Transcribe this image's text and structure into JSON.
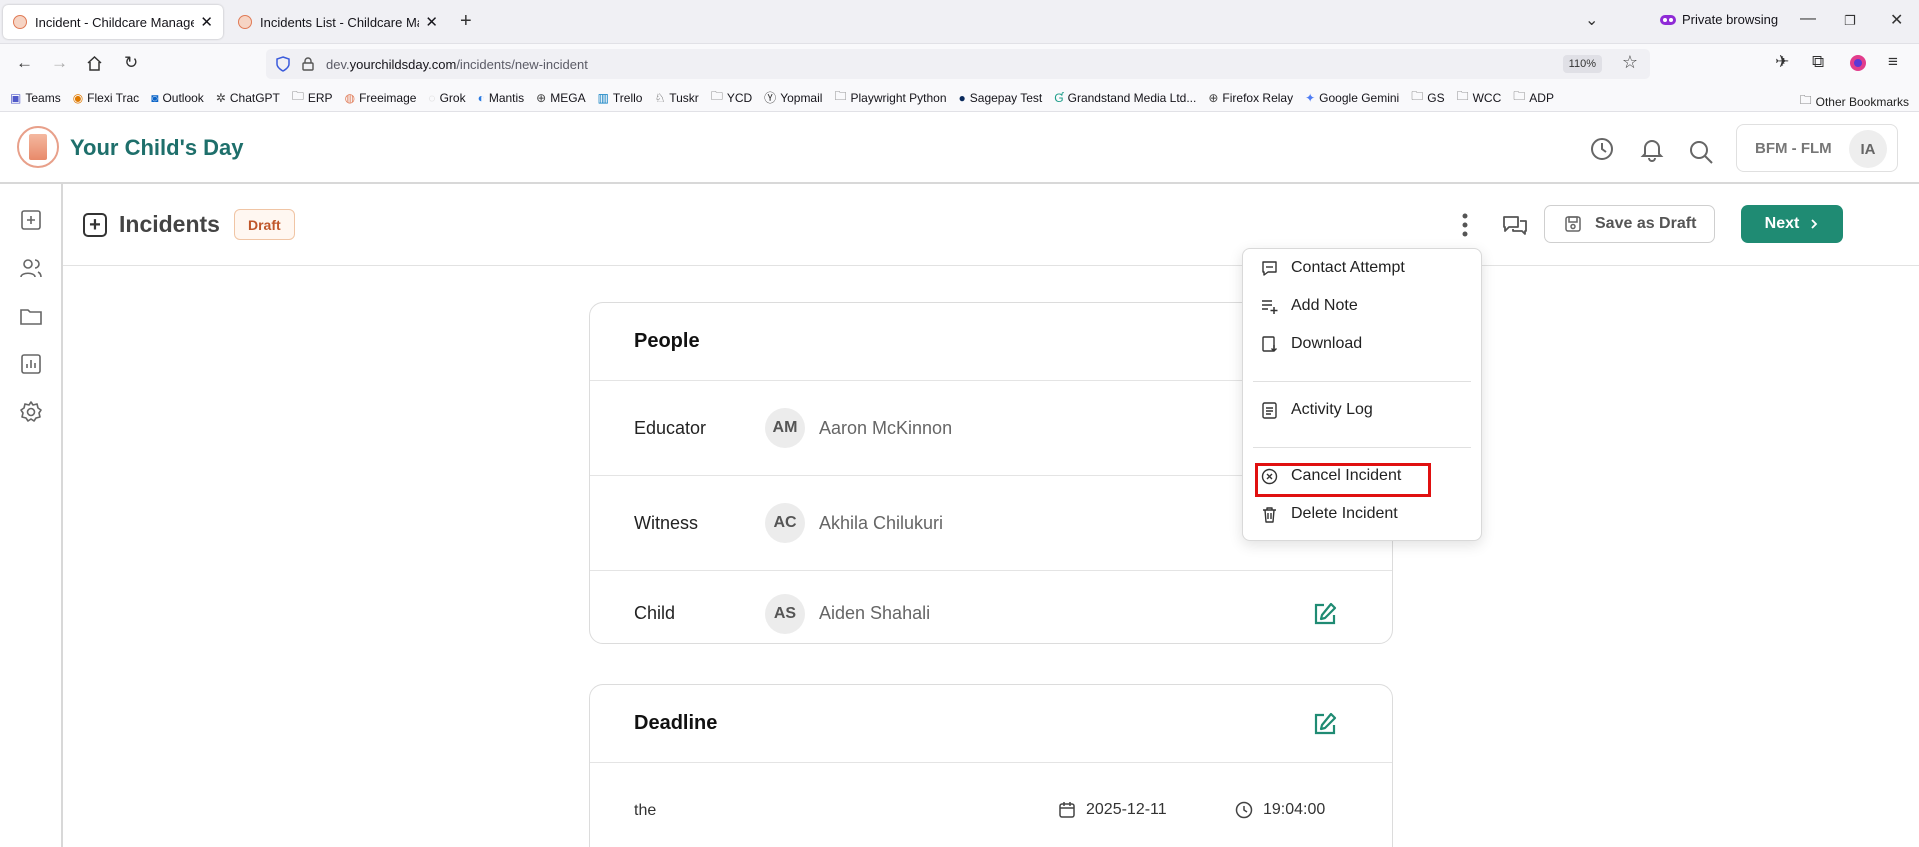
{
  "browser": {
    "tabs": [
      {
        "title": "Incident - Childcare Management",
        "close": "✕"
      },
      {
        "title": "Incidents List - Childcare Management",
        "close": "✕"
      }
    ],
    "new_tab": "+",
    "private_label": "Private browsing",
    "url_host_prefix": "dev.",
    "url_host": "yourchildsday.com",
    "url_path": "/incidents/new-incident",
    "zoom": "110%",
    "bookmarks": [
      "Teams",
      "Flexi Trac",
      "Outlook",
      "ChatGPT",
      "ERP",
      "Freeimage",
      "Grok",
      "Mantis",
      "MEGA",
      "Trello",
      "Tuskr",
      "YCD",
      "Yopmail",
      "Playwright Python",
      "Sagepay Test",
      "Grandstand Media Ltd...",
      "Firefox Relay",
      "Google Gemini",
      "GS",
      "WCC",
      "ADP"
    ],
    "other_bookmarks": "Other Bookmarks"
  },
  "app": {
    "brand": "Your Child's Day",
    "org": "BFM - FLM",
    "user_initials": "IA"
  },
  "page": {
    "title": "Incidents",
    "status": "Draft",
    "save_label": "Save as Draft",
    "next_label": "Next"
  },
  "people": {
    "heading": "People",
    "rows": [
      {
        "label": "Educator",
        "initials": "AM",
        "name": "Aaron McKinnon"
      },
      {
        "label": "Witness",
        "initials": "AC",
        "name": "Akhila Chilukuri"
      },
      {
        "label": "Child",
        "initials": "AS",
        "name": "Aiden Shahali"
      }
    ]
  },
  "deadline": {
    "heading": "Deadline",
    "label": "the",
    "date": "2025-12-11",
    "time": "19:04:00"
  },
  "menu": {
    "items": [
      {
        "label": "Contact Attempt",
        "icon": "message-icon"
      },
      {
        "label": "Add Note",
        "icon": "add-list-icon"
      },
      {
        "label": "Download",
        "icon": "download-icon"
      },
      {
        "label": "Activity Log",
        "icon": "log-icon"
      },
      {
        "label": "Cancel Incident",
        "icon": "cancel-circle-icon"
      },
      {
        "label": "Delete Incident",
        "icon": "trash-icon"
      }
    ]
  },
  "colors": {
    "brand": "#1e6f6b",
    "primary_button": "#1f8b73",
    "draft_badge": "#c0562a",
    "highlight": "#e01010"
  }
}
